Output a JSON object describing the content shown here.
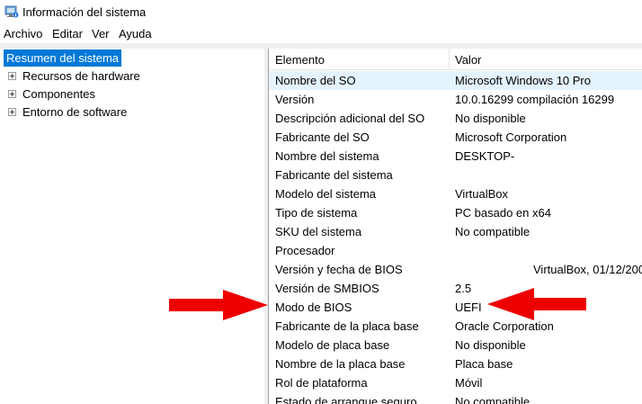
{
  "window": {
    "title": "Información del sistema"
  },
  "menu": [
    "Archivo",
    "Editar",
    "Ver",
    "Ayuda"
  ],
  "tree": {
    "root": "Resumen del sistema",
    "children": [
      "Recursos de hardware",
      "Componentes",
      "Entorno de software"
    ]
  },
  "table": {
    "headers": {
      "element": "Elemento",
      "value": "Valor"
    },
    "rows": [
      {
        "element": "Nombre del SO",
        "value": "Microsoft Windows 10 Pro"
      },
      {
        "element": "Versión",
        "value": "10.0.16299 compilación 16299"
      },
      {
        "element": "Descripción adicional del SO",
        "value": "No disponible"
      },
      {
        "element": "Fabricante del SO",
        "value": "Microsoft Corporation"
      },
      {
        "element": "Nombre del sistema",
        "value": "DESKTOP-"
      },
      {
        "element": "Fabricante del sistema",
        "value": ""
      },
      {
        "element": "Modelo del sistema",
        "value": "VirtualBox"
      },
      {
        "element": "Tipo de sistema",
        "value": "PC basado en x64"
      },
      {
        "element": "SKU del sistema",
        "value": "No compatible"
      },
      {
        "element": "Procesador",
        "value": ""
      },
      {
        "element": "Versión y fecha de BIOS",
        "value": "VirtualBox, 01/12/200"
      },
      {
        "element": "Versión de SMBIOS",
        "value": "2.5"
      },
      {
        "element": "Modo de BIOS",
        "value": "UEFI"
      },
      {
        "element": "Fabricante de la placa base",
        "value": "Oracle Corporation"
      },
      {
        "element": "Modelo de placa base",
        "value": "No disponible"
      },
      {
        "element": "Nombre de la placa base",
        "value": "Placa base"
      },
      {
        "element": "Rol de plataforma",
        "value": "Móvil"
      },
      {
        "element": "Estado de arranque seguro",
        "value": "No compatible"
      }
    ]
  },
  "annotations": {
    "arrow_color": "#ee0000"
  },
  "colors": {
    "selection": "#0078d7",
    "hover_row": "#e5f3ff"
  }
}
